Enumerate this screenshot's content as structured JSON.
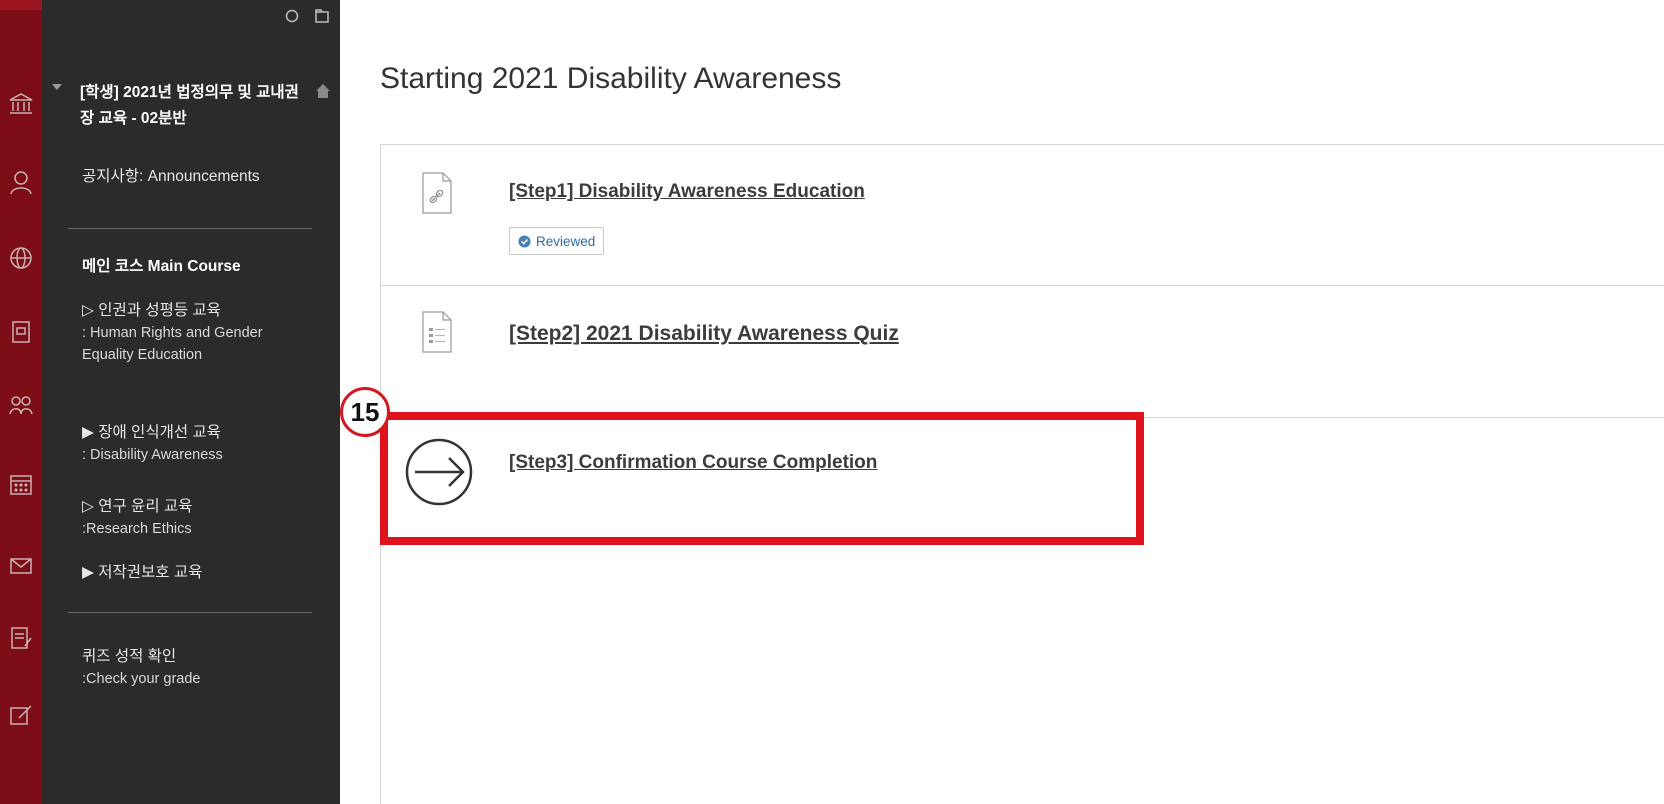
{
  "course": {
    "title": "[학생] 2021년 법정의무 및 교내권장 교육 - 02분반"
  },
  "menu": {
    "announcements": "공지사항: Announcements",
    "main_course": "메인 코스 Main Course",
    "items": [
      {
        "label": "▷ 인권과 성평등 교육",
        "sub": ": Human Rights and Gender Equality Education"
      },
      {
        "label": "▶ 장애 인식개선 교육",
        "sub": ": Disability Awareness"
      },
      {
        "label": "▷ 연구 윤리 교육",
        "sub": ":Research Ethics"
      },
      {
        "label": "▶ 저작권보호 교육",
        "sub": ""
      }
    ],
    "grades": {
      "label": "퀴즈 성적 확인",
      "sub": ":Check your grade"
    }
  },
  "page": {
    "title": "Starting 2021 Disability Awareness"
  },
  "content_items": [
    {
      "title": "[Step1] Disability Awareness Education",
      "icon": "link-document-icon",
      "badge": "Reviewed"
    },
    {
      "title": "[Step2] 2021 Disability Awareness Quiz",
      "icon": "test-document-icon"
    },
    {
      "title": "[Step3] Confirmation Course Completion",
      "icon": "arrow-circle-icon"
    }
  ],
  "annotation": {
    "step_number": "15"
  },
  "colors": {
    "brand_red": "#7c0d17",
    "menu_bg": "#2b2b2b",
    "highlight_red": "#e0121b"
  }
}
